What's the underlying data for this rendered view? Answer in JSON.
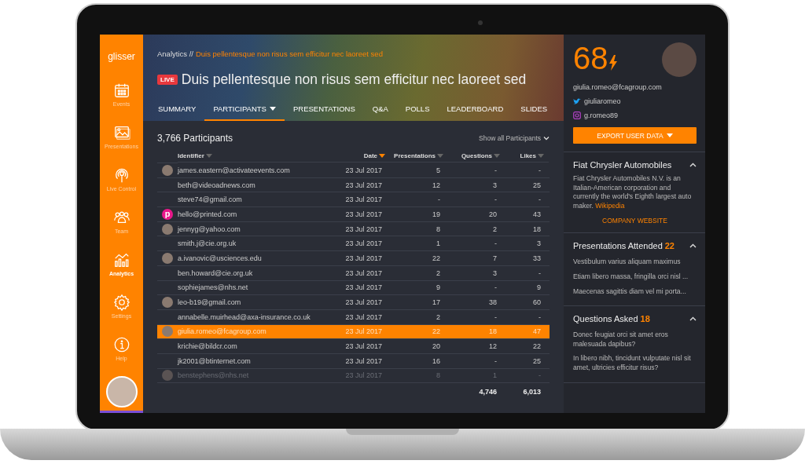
{
  "sidebar": {
    "logo": "glisser",
    "items": [
      {
        "label": "Events",
        "kind": "calendar",
        "selected": false
      },
      {
        "label": "Presentations",
        "kind": "image",
        "selected": false
      },
      {
        "label": "Live Control",
        "kind": "broadcast",
        "selected": false
      },
      {
        "label": "Team",
        "kind": "team",
        "selected": false
      },
      {
        "label": "Analytics",
        "kind": "chart",
        "selected": true
      },
      {
        "label": "Settings",
        "kind": "gear",
        "selected": false
      },
      {
        "label": "Help",
        "kind": "info",
        "selected": false
      }
    ]
  },
  "header": {
    "breadcrumb": {
      "parent": "Analytics //",
      "current": "Duis pellentesque non risus sem efficitur nec laoreet sed"
    },
    "live_badge": "LIVE",
    "title": "Duis pellentesque non risus sem efficitur nec laoreet sed",
    "tabs": [
      {
        "label": "SUMMARY",
        "selected": false,
        "dropdown": false
      },
      {
        "label": "PARTICIPANTS",
        "selected": true,
        "dropdown": true
      },
      {
        "label": "PRESENTATIONS",
        "selected": false,
        "dropdown": false
      },
      {
        "label": "Q&A",
        "selected": false,
        "dropdown": false
      },
      {
        "label": "POLLS",
        "selected": false,
        "dropdown": false
      },
      {
        "label": "LEADERBOARD",
        "selected": false,
        "dropdown": false
      },
      {
        "label": "SLIDES",
        "selected": false,
        "dropdown": false
      }
    ]
  },
  "table": {
    "title": "3,766 Participants",
    "filter": "Show all Participants",
    "columns": [
      {
        "label": "Identifier",
        "sorted": false
      },
      {
        "label": "Date",
        "sorted": true
      },
      {
        "label": "Presentations",
        "sorted": false
      },
      {
        "label": "Questions",
        "sorted": false
      },
      {
        "label": "Likes",
        "sorted": false
      }
    ],
    "rows": [
      {
        "kind": "photo",
        "identifier": "james.eastern@activateevents.com",
        "date": "23 Jul 2017",
        "presentations": "5",
        "questions": "-",
        "likes": "-",
        "selected": false,
        "faded": false
      },
      {
        "kind": "plain",
        "identifier": "beth@videoadnews.com",
        "date": "23 Jul 2017",
        "presentations": "12",
        "questions": "3",
        "likes": "25",
        "selected": false,
        "faded": false
      },
      {
        "kind": "plain",
        "identifier": "steve74@gmail.com",
        "date": "23 Jul 2017",
        "presentations": "-",
        "questions": "-",
        "likes": "-",
        "selected": false,
        "faded": false
      },
      {
        "kind": "logo",
        "avatar_text": "p",
        "identifier": "hello@printed.com",
        "date": "23 Jul 2017",
        "presentations": "19",
        "questions": "20",
        "likes": "43",
        "selected": false,
        "faded": false
      },
      {
        "kind": "photo",
        "identifier": "jennyg@yahoo.com",
        "date": "23 Jul 2017",
        "presentations": "8",
        "questions": "2",
        "likes": "18",
        "selected": false,
        "faded": false
      },
      {
        "kind": "plain",
        "identifier": "smith.j@cie.org.uk",
        "date": "23 Jul 2017",
        "presentations": "1",
        "questions": "-",
        "likes": "3",
        "selected": false,
        "faded": false
      },
      {
        "kind": "photo",
        "identifier": "a.ivanovic@usciences.edu",
        "date": "23 Jul 2017",
        "presentations": "22",
        "questions": "7",
        "likes": "33",
        "selected": false,
        "faded": false
      },
      {
        "kind": "plain",
        "identifier": "ben.howard@cie.org.uk",
        "date": "23 Jul 2017",
        "presentations": "2",
        "questions": "3",
        "likes": "-",
        "selected": false,
        "faded": false
      },
      {
        "kind": "plain",
        "identifier": "sophiejames@nhs.net",
        "date": "23 Jul 2017",
        "presentations": "9",
        "questions": "-",
        "likes": "9",
        "selected": false,
        "faded": false
      },
      {
        "kind": "photo",
        "identifier": "leo-b19@gmail.com",
        "date": "23 Jul 2017",
        "presentations": "17",
        "questions": "38",
        "likes": "60",
        "selected": false,
        "faded": false
      },
      {
        "kind": "plain",
        "identifier": "annabelle.muirhead@axa-insurance.co.uk",
        "date": "23 Jul 2017",
        "presentations": "2",
        "questions": "-",
        "likes": "-",
        "selected": false,
        "faded": false
      },
      {
        "kind": "photo",
        "identifier": "giulia.romeo@fcagroup.com",
        "date": "23 Jul 2017",
        "presentations": "22",
        "questions": "18",
        "likes": "47",
        "selected": true,
        "faded": false
      },
      {
        "kind": "plain",
        "identifier": "krichie@bildcr.com",
        "date": "23 Jul 2017",
        "presentations": "20",
        "questions": "12",
        "likes": "22",
        "selected": false,
        "faded": false
      },
      {
        "kind": "plain",
        "identifier": "jk2001@btinternet.com",
        "date": "23 Jul 2017",
        "presentations": "16",
        "questions": "-",
        "likes": "25",
        "selected": false,
        "faded": false
      },
      {
        "kind": "photo",
        "identifier": "benstephens@nhs.net",
        "date": "23 Jul 2017",
        "presentations": "8",
        "questions": "1",
        "likes": "-",
        "selected": false,
        "faded": true
      }
    ],
    "totals": {
      "questions": "4,746",
      "likes": "6,013"
    }
  },
  "profile": {
    "score": "68",
    "email": "giulia.romeo@fcagroup.com",
    "twitter": "giuliaromeo",
    "instagram": "g.romeo89",
    "export_button": "EXPORT USER DATA",
    "sections": [
      {
        "kind": "text",
        "title": "Fiat Chrysler Automobiles",
        "expanded": true,
        "text": "Fiat Chrysler Automobiles N.V. is an Italian-American corporation and currently the world's Eighth largest auto maker.",
        "link": "Wikipedia",
        "action": "COMPANY WEBSITE"
      },
      {
        "kind": "list",
        "title": "Presentations Attended",
        "count": "22",
        "expanded": true,
        "items": [
          "Vestibulum varius aliquam maximus",
          "Etiam libero massa, fringilla orci nisl ...",
          "Maecenas sagittis diam vel mi porta..."
        ]
      },
      {
        "kind": "list",
        "title": "Questions Asked",
        "count": "18",
        "expanded": true,
        "items": [
          "Donec feugiat orci sit amet eros malesuada dapibus?",
          "In libero nibh, tincidunt vulputate nisl sit amet, ultricies efficitur risus?"
        ]
      }
    ]
  }
}
